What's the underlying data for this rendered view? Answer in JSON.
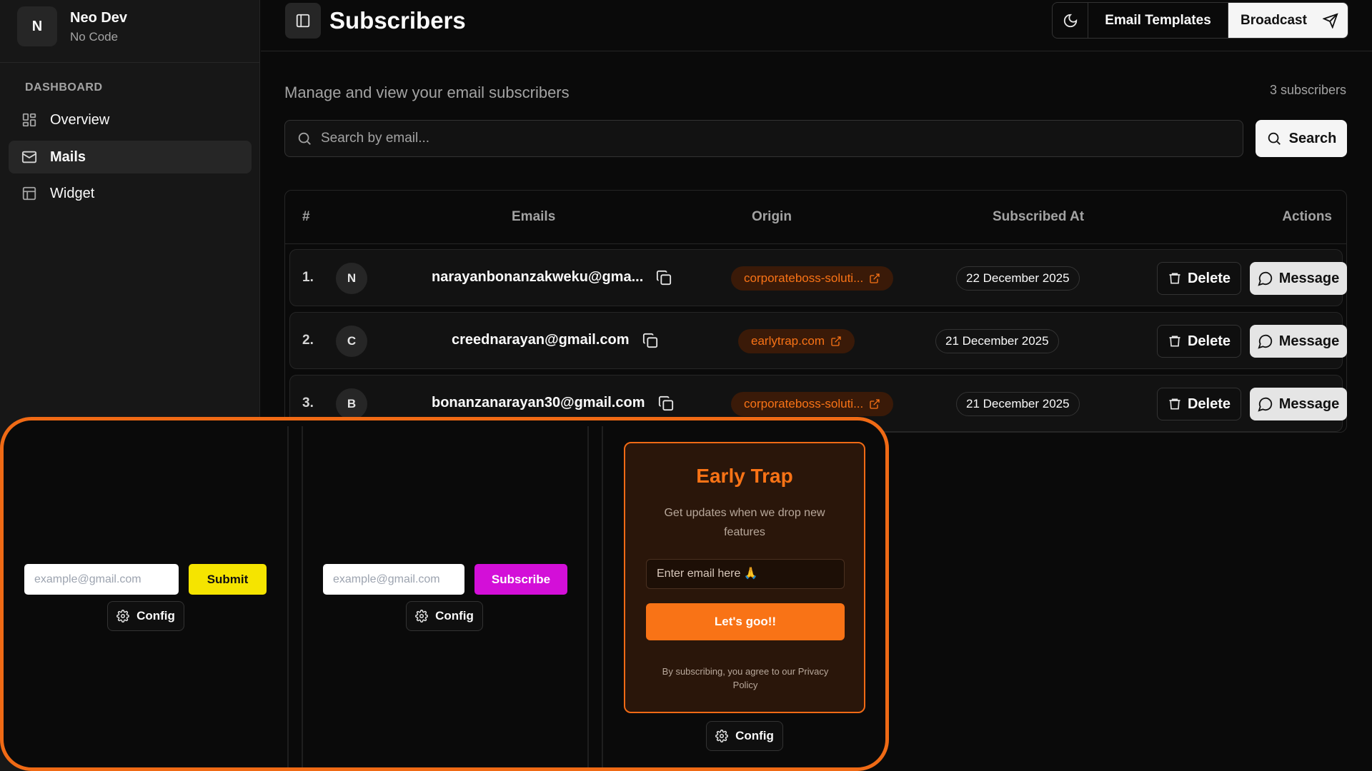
{
  "profile": {
    "initial": "N",
    "name": "Neo Dev",
    "subtitle": "No Code"
  },
  "sidebar": {
    "heading": "DASHBOARD",
    "items": [
      {
        "label": "Overview",
        "icon": "grid-icon",
        "active": false
      },
      {
        "label": "Mails",
        "icon": "mail-icon",
        "active": true
      },
      {
        "label": "Widget",
        "icon": "layout-icon",
        "active": false
      }
    ]
  },
  "header": {
    "title": "Subscribers",
    "templates_label": "Email Templates",
    "broadcast_label": "Broadcast"
  },
  "main": {
    "subtitle": "Manage and view your email subscribers",
    "count": "3 subscribers",
    "search_placeholder": "Search by email...",
    "search_label": "Search"
  },
  "table": {
    "columns": [
      "#",
      "Emails",
      "Origin",
      "Subscribed At",
      "Actions"
    ],
    "rows": [
      {
        "num": "1.",
        "initial": "N",
        "email": "narayanbonanzakweku@gma...",
        "origin": "corporateboss-soluti...",
        "date": "22 December 2025"
      },
      {
        "num": "2.",
        "initial": "C",
        "email": "creednarayan@gmail.com",
        "origin": "earlytrap.com",
        "date": "21 December 2025"
      },
      {
        "num": "3.",
        "initial": "B",
        "email": "bonanzanarayan30@gmail.com",
        "origin": "corporateboss-soluti...",
        "date": "21 December 2025"
      }
    ],
    "delete_label": "Delete",
    "message_label": "Message"
  },
  "widgets": {
    "config_label": "Config",
    "yellow": {
      "placeholder": "example@gmail.com",
      "button": "Submit",
      "color": "#f5e400"
    },
    "purple": {
      "placeholder": "example@gmail.com",
      "button": "Subscribe",
      "color": "#d30fd8"
    },
    "early": {
      "title": "Early Trap",
      "description": "Get updates when we drop new features",
      "placeholder": "Enter email here 🙏",
      "button": "Let's goo!!",
      "legal": "By subscribing, you agree to our Privacy Policy",
      "accent": "#f97316"
    }
  },
  "colors": {
    "highlight": "#f06a15",
    "origin_text": "#f97316"
  }
}
